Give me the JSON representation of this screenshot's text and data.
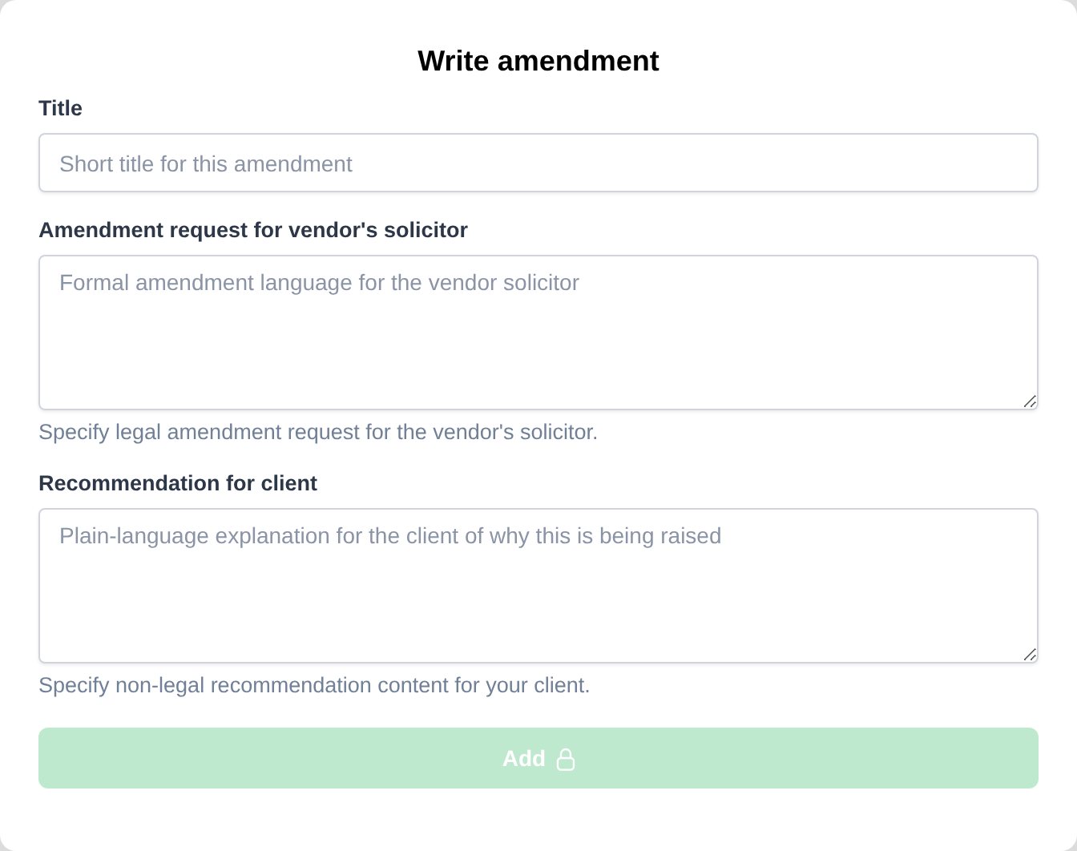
{
  "title": "Write amendment",
  "fields": [
    {
      "kind": "input",
      "label": "Title",
      "placeholder": "Short title for this amendment"
    },
    {
      "kind": "textarea",
      "label": "Amendment request for vendor's solicitor",
      "placeholder": "Formal amendment language for the vendor solicitor",
      "help": "Specify legal amendment request for the vendor's solicitor."
    },
    {
      "kind": "textarea",
      "label": "Recommendation for client",
      "placeholder": "Plain-language explanation for the client of why this is being raised",
      "help": "Specify non-legal recommendation content for your client."
    }
  ],
  "button": {
    "label": "Add",
    "disabled": true
  }
}
